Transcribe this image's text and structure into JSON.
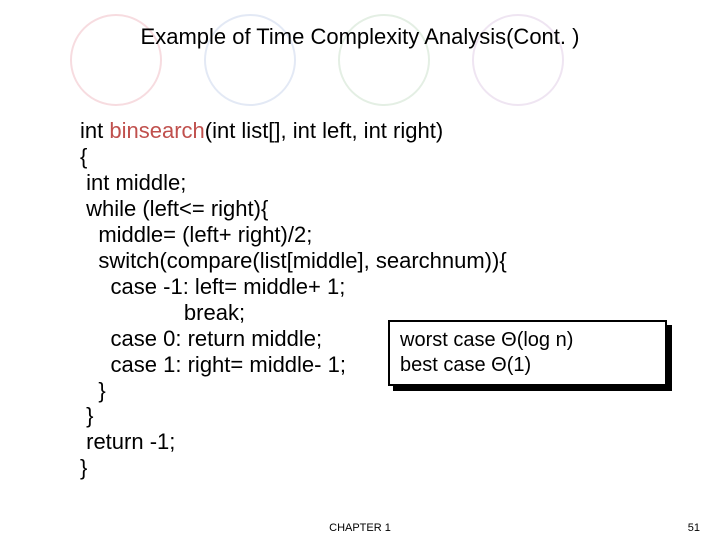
{
  "title": "Example of Time Complexity Analysis(Cont. )",
  "code": {
    "l1_a": "int ",
    "l1_fn": "binsearch",
    "l1_b": "(int list[], int left, int right)",
    "l2": "{",
    "l3": " int middle;",
    "l4": " while (left<= right){",
    "l5": "   middle= (left+ right)/2;",
    "l6": "   switch(compare(list[middle], searchnum)){",
    "l7": "     case -1: left= middle+ 1;",
    "l8": "                 break;",
    "l9": "     case 0: return middle;",
    "l10": "     case 1: right= middle- 1;",
    "l11": "   }",
    "l12": " }",
    "l13": " return -1;",
    "l14": "}"
  },
  "callout": {
    "line1": "worst case Θ(log n)",
    "line2": "best case Θ(1)"
  },
  "footer": {
    "chapter": "CHAPTER 1",
    "page": "51"
  },
  "colors": {
    "c1": "#f7dce0",
    "c2": "#e3e9f5",
    "c3": "#e4efe4",
    "c4": "#efe5f2"
  }
}
